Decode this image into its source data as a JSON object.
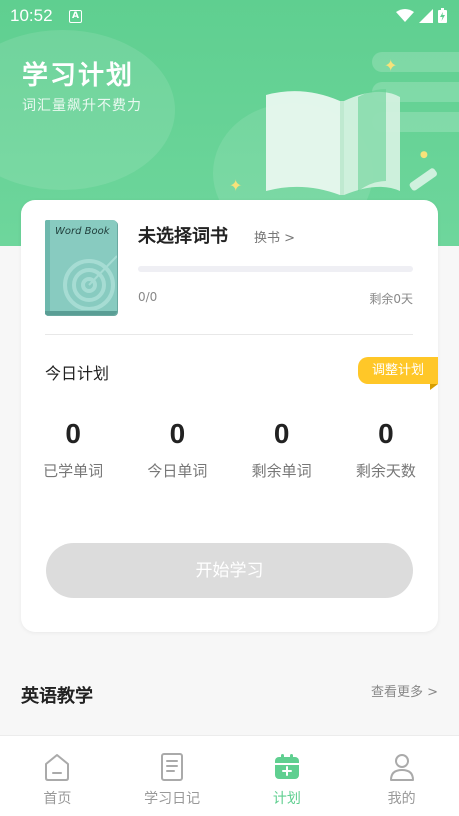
{
  "status_bar": {
    "time": "10:52",
    "notification_icon": "A"
  },
  "hero": {
    "title": "学习计划",
    "subtitle": "词汇量飙升不费力"
  },
  "current_book": {
    "cover_text": "Word Book",
    "title": "未选择词书",
    "change_label": "换书 >",
    "progress_fraction": 0,
    "progress_text": "0/0",
    "remaining_days_text": "剩余0天"
  },
  "today_plan": {
    "title": "今日计划",
    "adjust_label": "调整计划",
    "stats": [
      {
        "value": "0",
        "label": "已学单词"
      },
      {
        "value": "0",
        "label": "今日单词"
      },
      {
        "value": "0",
        "label": "剩余单词"
      },
      {
        "value": "0",
        "label": "剩余天数"
      }
    ],
    "start_label": "开始学习"
  },
  "english_teaching": {
    "title": "英语教学",
    "more_label": "查看更多 >"
  },
  "tabs": [
    {
      "label": "首页",
      "icon": "home-icon",
      "active": false
    },
    {
      "label": "学习日记",
      "icon": "diary-icon",
      "active": false
    },
    {
      "label": "计划",
      "icon": "calendar-icon",
      "active": true
    },
    {
      "label": "我的",
      "icon": "profile-icon",
      "active": false
    }
  ],
  "colors": {
    "brand_green": "#5fcf90",
    "accent_yellow": "#ffc728",
    "disabled_gray": "#dcdcdc"
  }
}
